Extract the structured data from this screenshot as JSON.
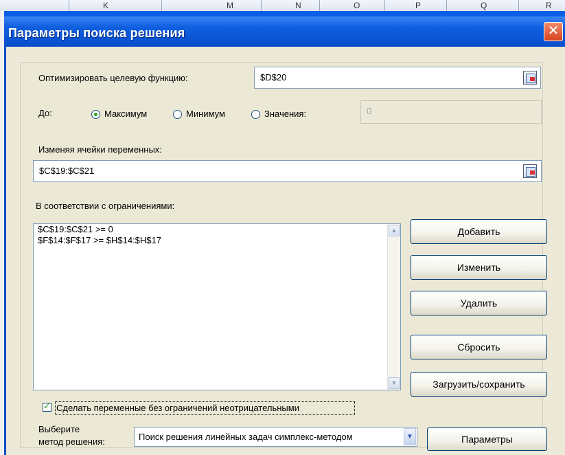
{
  "window": {
    "title": "Параметры поиска решения",
    "close_label": "✕"
  },
  "objective": {
    "label": "Оптимизировать целевую функцию:",
    "value": "$D$20"
  },
  "goal": {
    "label": "До:",
    "max_label": "Максимум",
    "min_label": "Минимум",
    "value_label": "Значения:",
    "value_input": "0",
    "selected": "Максимум"
  },
  "variables": {
    "label": "Изменяя ячейки переменных:",
    "value": "$C$19:$C$21"
  },
  "constraints": {
    "label": "В соответствии с ограничениями:",
    "items": [
      "$C$19:$C$21 >= 0",
      "$F$14:$F$17 >= $H$14:$H$17"
    ]
  },
  "buttons": {
    "add": "Добавить",
    "change": "Изменить",
    "delete": "Удалить",
    "reset": "Сбросить",
    "load_save": "Загрузить/сохранить",
    "options": "Параметры"
  },
  "nonneg": {
    "label": "Сделать переменные без ограничений неотрицательными",
    "checked": true
  },
  "method": {
    "label_line1": "Выберите",
    "label_line2": "метод решения:",
    "selected": "Поиск решения линейных задач симплекс-методом"
  },
  "sheet": {
    "column_letters": [
      "K",
      "M",
      "N",
      "O",
      "P",
      "Q",
      "R"
    ]
  },
  "colors": {
    "title_bar": "#0a5fe6",
    "dialog_bg": "#ece9d8",
    "close_button": "#d8431e",
    "radio_dot": "#21a121"
  }
}
